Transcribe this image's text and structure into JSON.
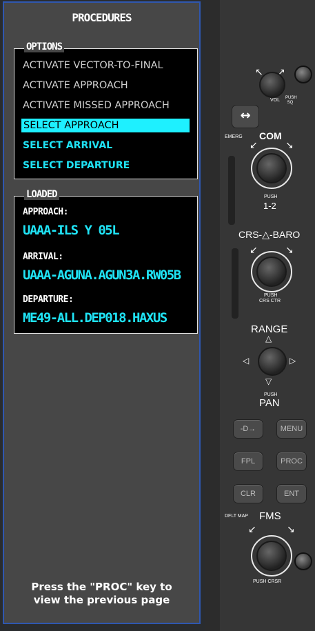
{
  "window": {
    "title": "PROCEDURES"
  },
  "options": {
    "legend": "OPTIONS",
    "items": [
      {
        "label": "ACTIVATE VECTOR-TO-FINAL"
      },
      {
        "label": "ACTIVATE APPROACH"
      },
      {
        "label": "ACTIVATE MISSED APPROACH"
      },
      {
        "label": "SELECT APPROACH"
      },
      {
        "label": "SELECT ARRIVAL"
      },
      {
        "label": "SELECT DEPARTURE"
      }
    ]
  },
  "loaded": {
    "legend": "LOADED",
    "approach_label": "APPROACH:",
    "approach_value": "UAAA-ILS Y 05L",
    "arrival_label": "ARRIVAL:",
    "arrival_value": "UAAA-AGUNA.AGUN3A.RW05B",
    "departure_label": "DEPARTURE:",
    "departure_value": "ME49-ALL.DEP018.HAXUS"
  },
  "footer": {
    "line1": "Press the \"PROC\" key to",
    "line2": "view the previous page"
  },
  "bezel": {
    "vol_label": "VOL",
    "vol_push": "PUSH SQ",
    "emerg_label": "EMERG",
    "com_label": "COM",
    "com_push": "PUSH",
    "com_push2": "1-2",
    "crs_label": "CRS-△-BARO",
    "crs_push": "PUSH",
    "crs_push2": "CRS CTR",
    "range_label": "RANGE",
    "range_push": "PUSH",
    "range_push2": "PAN",
    "direct_key": "-D→",
    "menu_key": "MENU",
    "fpl_key": "FPL",
    "proc_key": "PROC",
    "clr_key": "CLR",
    "ent_key": "ENT",
    "dflt_map": "DFLT MAP",
    "fms_label": "FMS",
    "fms_push": "PUSH CRSR",
    "swap_symbol": "↔"
  },
  "colors": {
    "cyan": "#1fe3f5",
    "highlight": "#1ef0ff",
    "window_border": "#2f57b0"
  }
}
